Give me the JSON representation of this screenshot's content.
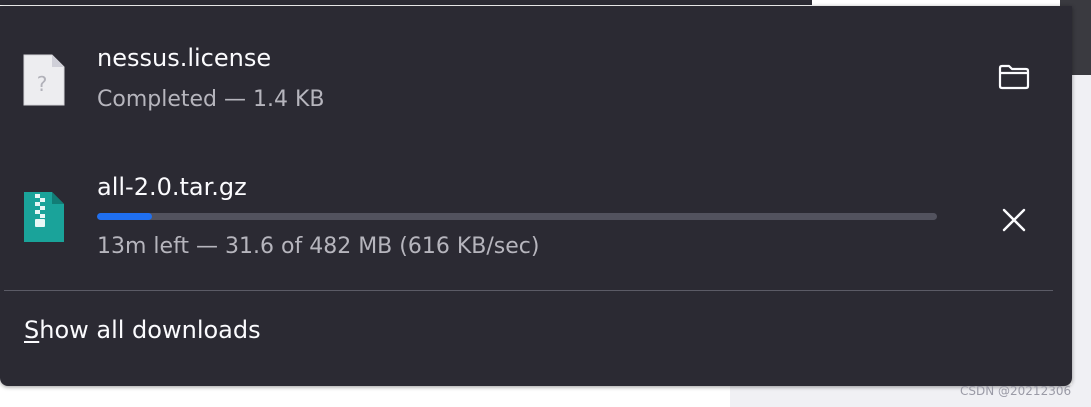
{
  "downloads": [
    {
      "file_name": "nessus.license",
      "status": "Completed — 1.4 KB",
      "icon": "unknown-file-icon",
      "action": "open-folder",
      "icon_glyph": "?"
    },
    {
      "file_name": "all-2.0.tar.gz",
      "status": "13m left — 31.6 of 482 MB (616 KB/sec)",
      "icon": "archive-file-icon",
      "action": "cancel",
      "progress_fraction": 0.066
    }
  ],
  "footer": {
    "show_all_accesskey": "S",
    "show_all_rest": "how all downloads"
  },
  "watermark": "CSDN @20212306",
  "colors": {
    "panel_bg": "#2b2a33",
    "text_primary": "#fbfbfe",
    "text_secondary": "#b6b5bd",
    "progress_fill": "#1f6ff0",
    "progress_track": "#52525e",
    "archive_icon": "#1aa39a"
  }
}
